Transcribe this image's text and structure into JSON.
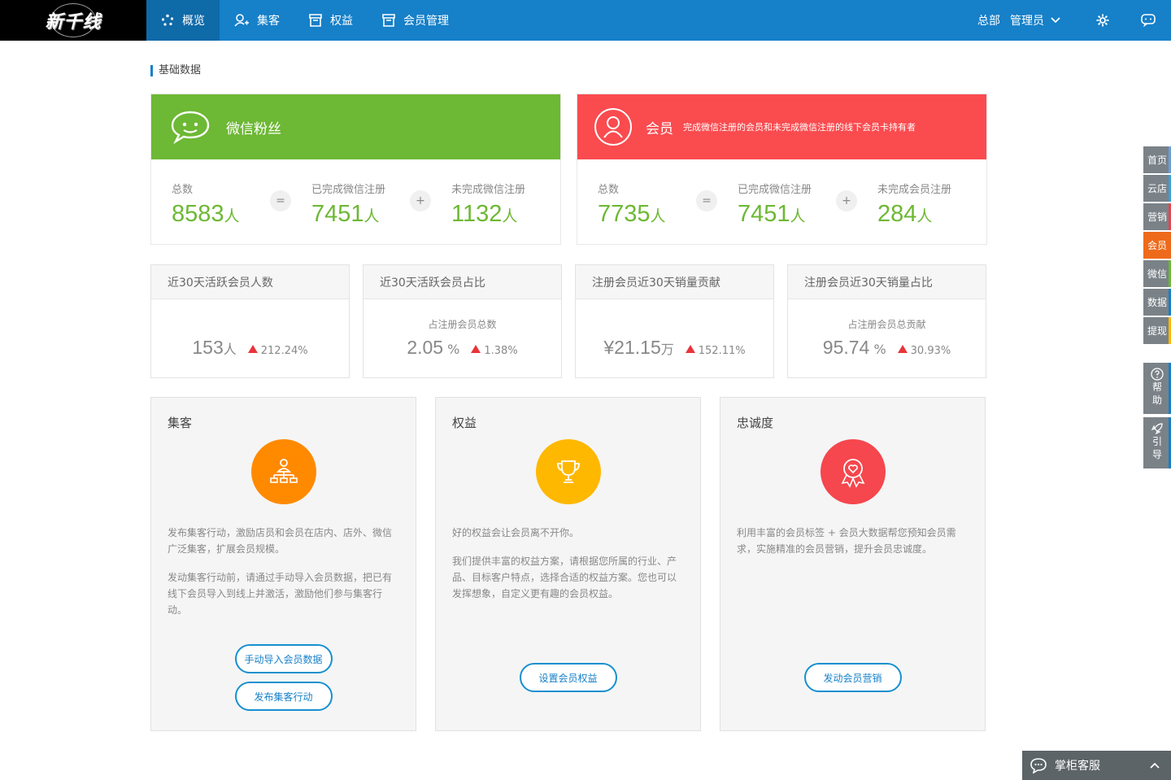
{
  "app": {
    "logo_text": "新千线"
  },
  "nav": [
    {
      "label": "概览",
      "icon": "overview-icon"
    },
    {
      "label": "集客",
      "icon": "add-user-icon"
    },
    {
      "label": "权益",
      "icon": "store-icon"
    },
    {
      "label": "会员管理",
      "icon": "store-icon"
    }
  ],
  "top_right": {
    "org": "总部",
    "user": "管理员"
  },
  "section_title": "基础数据",
  "wechat": {
    "title": "微信粉丝",
    "stats": [
      {
        "label": "总数",
        "value": "8583",
        "unit": "人"
      },
      {
        "label": "已完成微信注册",
        "value": "7451",
        "unit": "人"
      },
      {
        "label": "未完成微信注册",
        "value": "1132",
        "unit": "人"
      }
    ],
    "ops": [
      "=",
      "+"
    ]
  },
  "member": {
    "title": "会员",
    "subtitle": "完成微信注册的会员和未完成微信注册的线下会员卡持有者",
    "stats": [
      {
        "label": "总数",
        "value": "7735",
        "unit": "人"
      },
      {
        "label": "已完成微信注册",
        "value": "7451",
        "unit": "人"
      },
      {
        "label": "未完成会员注册",
        "value": "284",
        "unit": "人"
      }
    ],
    "ops": [
      "=",
      "+"
    ]
  },
  "metrics": [
    {
      "title": "近30天活跃会员人数",
      "sub": "",
      "value": "153",
      "unit": "人",
      "change": "212.24%"
    },
    {
      "title": "近30天活跃会员占比",
      "sub": "占注册会员总数",
      "value": "2.05",
      "unit": "%",
      "change": "1.38%"
    },
    {
      "title": "注册会员近30天销量贡献",
      "sub": "",
      "value": "¥21.15",
      "unit": "万",
      "change": "152.11%"
    },
    {
      "title": "注册会员近30天销量占比",
      "sub": "占注册会员总贡献",
      "value": "95.74",
      "unit": "%",
      "change": "30.93%"
    }
  ],
  "features": [
    {
      "title": "集客",
      "icon": "org-chart-icon",
      "color": "#ff8a00",
      "paragraphs": [
        "发布集客行动，激励店员和会员在店内、店外、微信广泛集客，扩展会员规模。",
        "发动集客行动前，请通过手动导入会员数据，把已有线下会员导入到线上并激活，激励他们参与集客行动。"
      ],
      "buttons": [
        "手动导入会员数据",
        "发布集客行动"
      ]
    },
    {
      "title": "权益",
      "icon": "trophy-icon",
      "color": "#ffb800",
      "paragraphs": [
        "好的权益会让会员离不开你。",
        "我们提供丰富的权益方案，请根据您所属的行业、产品、目标客户特点，选择合适的权益方案。您也可以发挥想象，自定义更有趣的会员权益。"
      ],
      "buttons": [
        "设置会员权益"
      ]
    },
    {
      "title": "忠诚度",
      "icon": "heart-badge-icon",
      "color": "#f5474d",
      "paragraphs": [
        "利用丰富的会员标签 + 会员大数据帮您预知会员需求，实施精准的会员营销，提升会员忠诚度。"
      ],
      "buttons": [
        "发动会员营销"
      ]
    }
  ],
  "side_nav": [
    {
      "label": "首页",
      "accent": "#6aa0d8"
    },
    {
      "label": "云店",
      "accent": "#3aa0d8"
    },
    {
      "label": "营销",
      "accent": "#e8434b"
    },
    {
      "label": "会员",
      "accent": "#ee6a1a",
      "active": true
    },
    {
      "label": "微信",
      "accent": "#6db834"
    },
    {
      "label": "数据",
      "accent": "#1680c9"
    },
    {
      "label": "提现",
      "accent": "#ffb800"
    }
  ],
  "side_tools": [
    {
      "chars": [
        "帮",
        "助"
      ],
      "icon": "help-icon"
    },
    {
      "chars": [
        "引",
        "导"
      ],
      "icon": "rocket-icon"
    }
  ],
  "kefu": {
    "label": "掌柜客服"
  }
}
